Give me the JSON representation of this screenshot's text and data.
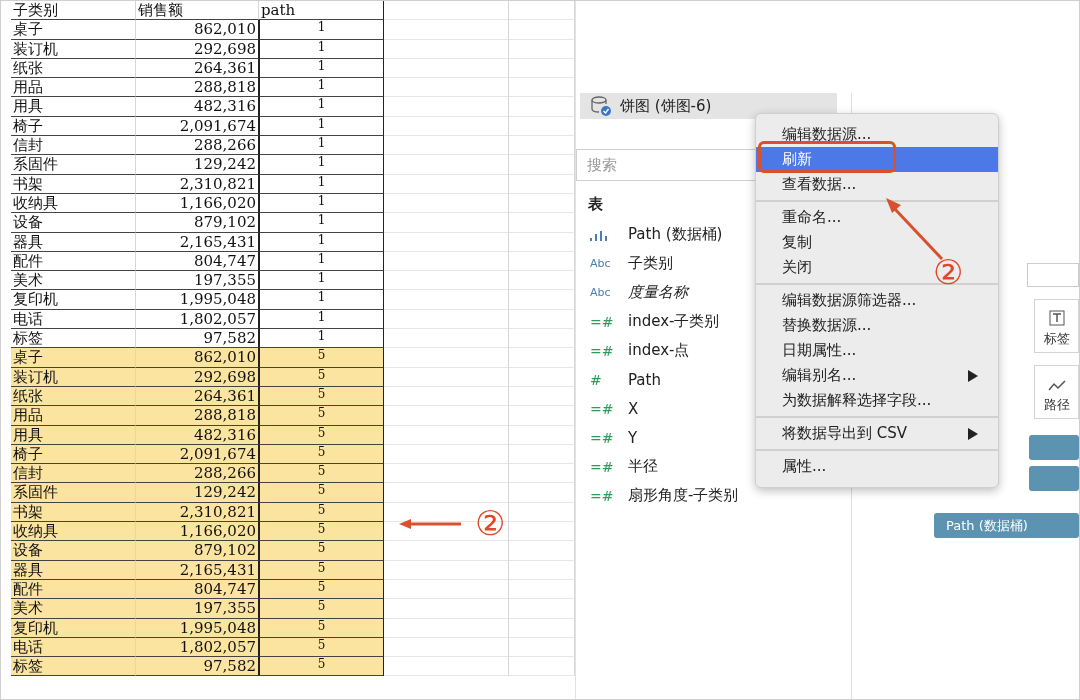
{
  "sheet": {
    "columns": [
      "子类别",
      "销售额",
      "path"
    ],
    "rows": [
      {
        "cells": [
          "桌子",
          "862,010",
          "1"
        ],
        "highlighted": false
      },
      {
        "cells": [
          "装订机",
          "292,698",
          "1"
        ],
        "highlighted": false
      },
      {
        "cells": [
          "纸张",
          "264,361",
          "1"
        ],
        "highlighted": false
      },
      {
        "cells": [
          "用品",
          "288,818",
          "1"
        ],
        "highlighted": false
      },
      {
        "cells": [
          "用具",
          "482,316",
          "1"
        ],
        "highlighted": false
      },
      {
        "cells": [
          "椅子",
          "2,091,674",
          "1"
        ],
        "highlighted": false
      },
      {
        "cells": [
          "信封",
          "288,266",
          "1"
        ],
        "highlighted": false
      },
      {
        "cells": [
          "系固件",
          "129,242",
          "1"
        ],
        "highlighted": false
      },
      {
        "cells": [
          "书架",
          "2,310,821",
          "1"
        ],
        "highlighted": false
      },
      {
        "cells": [
          "收纳具",
          "1,166,020",
          "1"
        ],
        "highlighted": false
      },
      {
        "cells": [
          "设备",
          "879,102",
          "1"
        ],
        "highlighted": false
      },
      {
        "cells": [
          "器具",
          "2,165,431",
          "1"
        ],
        "highlighted": false
      },
      {
        "cells": [
          "配件",
          "804,747",
          "1"
        ],
        "highlighted": false
      },
      {
        "cells": [
          "美术",
          "197,355",
          "1"
        ],
        "highlighted": false
      },
      {
        "cells": [
          "复印机",
          "1,995,048",
          "1"
        ],
        "highlighted": false
      },
      {
        "cells": [
          "电话",
          "1,802,057",
          "1"
        ],
        "highlighted": false
      },
      {
        "cells": [
          "标签",
          "97,582",
          "1"
        ],
        "highlighted": false
      },
      {
        "cells": [
          "桌子",
          "862,010",
          "5"
        ],
        "highlighted": true
      },
      {
        "cells": [
          "装订机",
          "292,698",
          "5"
        ],
        "highlighted": true
      },
      {
        "cells": [
          "纸张",
          "264,361",
          "5"
        ],
        "highlighted": true
      },
      {
        "cells": [
          "用品",
          "288,818",
          "5"
        ],
        "highlighted": true
      },
      {
        "cells": [
          "用具",
          "482,316",
          "5"
        ],
        "highlighted": true
      },
      {
        "cells": [
          "椅子",
          "2,091,674",
          "5"
        ],
        "highlighted": true
      },
      {
        "cells": [
          "信封",
          "288,266",
          "5"
        ],
        "highlighted": true
      },
      {
        "cells": [
          "系固件",
          "129,242",
          "5"
        ],
        "highlighted": true
      },
      {
        "cells": [
          "书架",
          "2,310,821",
          "5"
        ],
        "highlighted": true
      },
      {
        "cells": [
          "收纳具",
          "1,166,020",
          "5"
        ],
        "highlighted": true
      },
      {
        "cells": [
          "设备",
          "879,102",
          "5"
        ],
        "highlighted": true
      },
      {
        "cells": [
          "器具",
          "2,165,431",
          "5"
        ],
        "highlighted": true
      },
      {
        "cells": [
          "配件",
          "804,747",
          "5"
        ],
        "highlighted": true
      },
      {
        "cells": [
          "美术",
          "197,355",
          "5"
        ],
        "highlighted": true
      },
      {
        "cells": [
          "复印机",
          "1,995,048",
          "5"
        ],
        "highlighted": true
      },
      {
        "cells": [
          "电话",
          "1,802,057",
          "5"
        ],
        "highlighted": true
      },
      {
        "cells": [
          "标签",
          "97,582",
          "5"
        ],
        "highlighted": true
      }
    ]
  },
  "data_pane": {
    "datasource": "饼图 (饼图-6)",
    "search": {
      "placeholder": "搜索"
    },
    "section": "表",
    "fields": [
      {
        "name": "Path (数据桶)",
        "kind": "bin"
      },
      {
        "name": "子类别",
        "kind": "text",
        "type_icon": "Abc"
      },
      {
        "name": "度量名称",
        "kind": "text",
        "type_icon": "Abc",
        "italic": true
      },
      {
        "name": "index-子类别",
        "kind": "number",
        "type_icon": "=#"
      },
      {
        "name": "index-点",
        "kind": "number",
        "type_icon": "=#"
      },
      {
        "name": "Path",
        "kind": "number",
        "type_icon": "#"
      },
      {
        "name": "X",
        "kind": "number",
        "type_icon": "=#"
      },
      {
        "name": "Y",
        "kind": "number",
        "type_icon": "=#"
      },
      {
        "name": "半径",
        "kind": "number",
        "type_icon": "=#"
      },
      {
        "name": "扇形角度-子类别",
        "kind": "number",
        "type_icon": "=#"
      }
    ]
  },
  "marks_card": {
    "buttons": [
      {
        "label": "标签",
        "kind": "text"
      },
      {
        "label": "路径",
        "kind": "path"
      }
    ],
    "pill": "Path (数据桶)"
  },
  "context_menu": {
    "groups": [
      [
        {
          "label": "编辑数据源...",
          "selected": false,
          "submenu": false
        },
        {
          "label": "刷新",
          "selected": true,
          "submenu": false
        },
        {
          "label": "查看数据...",
          "selected": false,
          "submenu": false
        }
      ],
      [
        {
          "label": "重命名...",
          "selected": false,
          "submenu": false
        },
        {
          "label": "复制",
          "selected": false,
          "submenu": false
        },
        {
          "label": "关闭",
          "selected": false,
          "submenu": false
        }
      ],
      [
        {
          "label": "编辑数据源筛选器...",
          "selected": false,
          "submenu": false
        },
        {
          "label": "替换数据源...",
          "selected": false,
          "submenu": false
        },
        {
          "label": "日期属性...",
          "selected": false,
          "submenu": false
        },
        {
          "label": "编辑别名...",
          "selected": false,
          "submenu": true
        },
        {
          "label": "为数据解释选择字段...",
          "selected": false,
          "submenu": false
        }
      ],
      [
        {
          "label": "将数据导出到 CSV",
          "selected": false,
          "submenu": true
        }
      ],
      [
        {
          "label": "属性...",
          "selected": false,
          "submenu": false
        }
      ]
    ]
  },
  "annotations": [
    {
      "text": "②"
    },
    {
      "text": "②"
    }
  ]
}
